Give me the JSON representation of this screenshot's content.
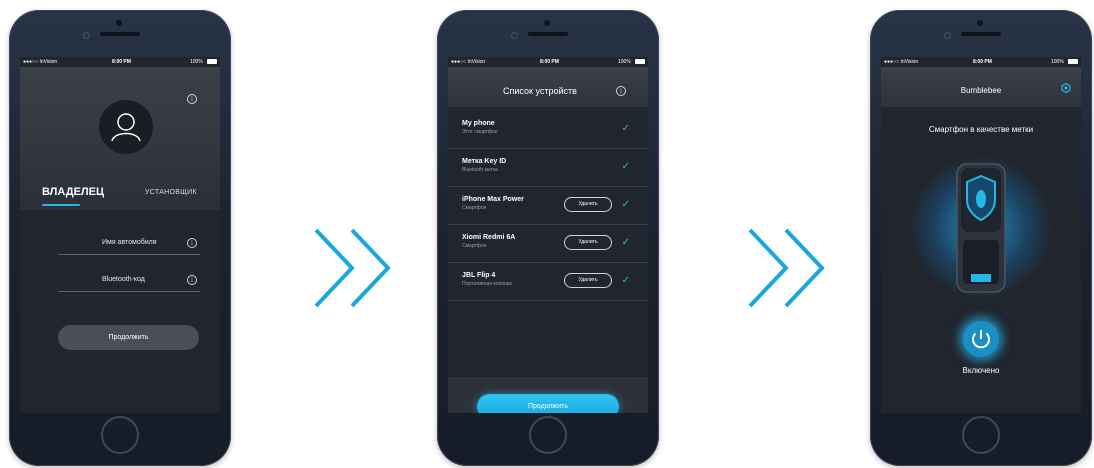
{
  "status_bar": {
    "carrier": "●●●○○ InVision",
    "time": "8:00 PM",
    "battery": "100%"
  },
  "screen1": {
    "tab_owner": "ВЛАДЕЛЕЦ",
    "tab_installer": "УСТАНОВЩИК",
    "field_car_name": "Имя автомобиля",
    "field_bluetooth": "Bluetooth-код",
    "continue": "Продолжить",
    "info_glyph": "i"
  },
  "screen2": {
    "title": "Список устройств",
    "info_glyph": "i",
    "devices": [
      {
        "name": "My phone",
        "type": "Этот смартфон",
        "removable": false
      },
      {
        "name": "Метка Key ID",
        "type": "Bluetooth метка",
        "removable": false
      },
      {
        "name": "iPhone Max Power",
        "type": "Смартфон",
        "removable": true
      },
      {
        "name": "Xiomi Redmi 6A",
        "type": "Смартфон",
        "removable": true
      },
      {
        "name": "JBL Flip 4",
        "type": "Портативная колонка",
        "removable": true
      }
    ],
    "remove_label": "Удалить",
    "check_glyph": "✓",
    "continue": "Продолжить"
  },
  "screen3": {
    "title": "Bumblebee",
    "subtitle": "Смартфон в качестве метки",
    "status": "Включено"
  },
  "colors": {
    "accent": "#27b6e8",
    "check": "#2ecc71",
    "chevron": "#1aa7e0"
  },
  "icons": [
    "info-icon",
    "avatar-icon",
    "check-icon",
    "power-icon",
    "gear-icon",
    "key-fob-icon",
    "chevron-right-icon"
  ]
}
